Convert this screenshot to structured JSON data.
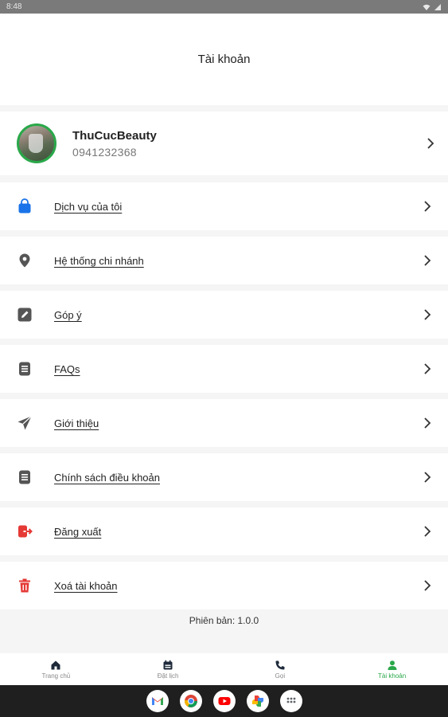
{
  "status_bar": {
    "time": "8:48"
  },
  "header": {
    "title": "Tài khoản"
  },
  "profile": {
    "name": "ThuCucBeauty",
    "phone": "0941232368"
  },
  "menu": [
    {
      "label": "Dịch vụ của tôi",
      "icon": "shopping-bag-icon",
      "color": "#1a73e8"
    },
    {
      "label": "Hệ thống chi nhánh",
      "icon": "location-pin-icon",
      "color": "#555555"
    },
    {
      "label": "Góp ý",
      "icon": "edit-icon",
      "color": "#555555"
    },
    {
      "label": "FAQs",
      "icon": "document-icon",
      "color": "#555555"
    },
    {
      "label": "Giới thiệu",
      "icon": "send-icon",
      "color": "#555555"
    },
    {
      "label": "Chính sách điều khoản",
      "icon": "document-icon",
      "color": "#555555"
    },
    {
      "label": "Đăng xuất",
      "icon": "logout-icon",
      "color": "#e53935"
    },
    {
      "label": "Xoá tài khoản",
      "icon": "trash-icon",
      "color": "#e53935"
    }
  ],
  "version": {
    "text": "Phiên bản:  1.0.0"
  },
  "bottom_nav": [
    {
      "label": "Trang chủ",
      "icon": "home-icon",
      "active": false
    },
    {
      "label": "Đặt lịch",
      "icon": "calendar-icon",
      "active": false
    },
    {
      "label": "Gọi",
      "icon": "phone-icon",
      "active": false
    },
    {
      "label": "Tài khoản",
      "icon": "user-icon",
      "active": true
    }
  ],
  "colors": {
    "accent": "#2aa84a",
    "danger": "#e53935",
    "primary": "#1a73e8"
  },
  "dock_apps": [
    "gmail-icon",
    "chrome-icon",
    "youtube-icon",
    "photos-icon",
    "apps-icon"
  ]
}
